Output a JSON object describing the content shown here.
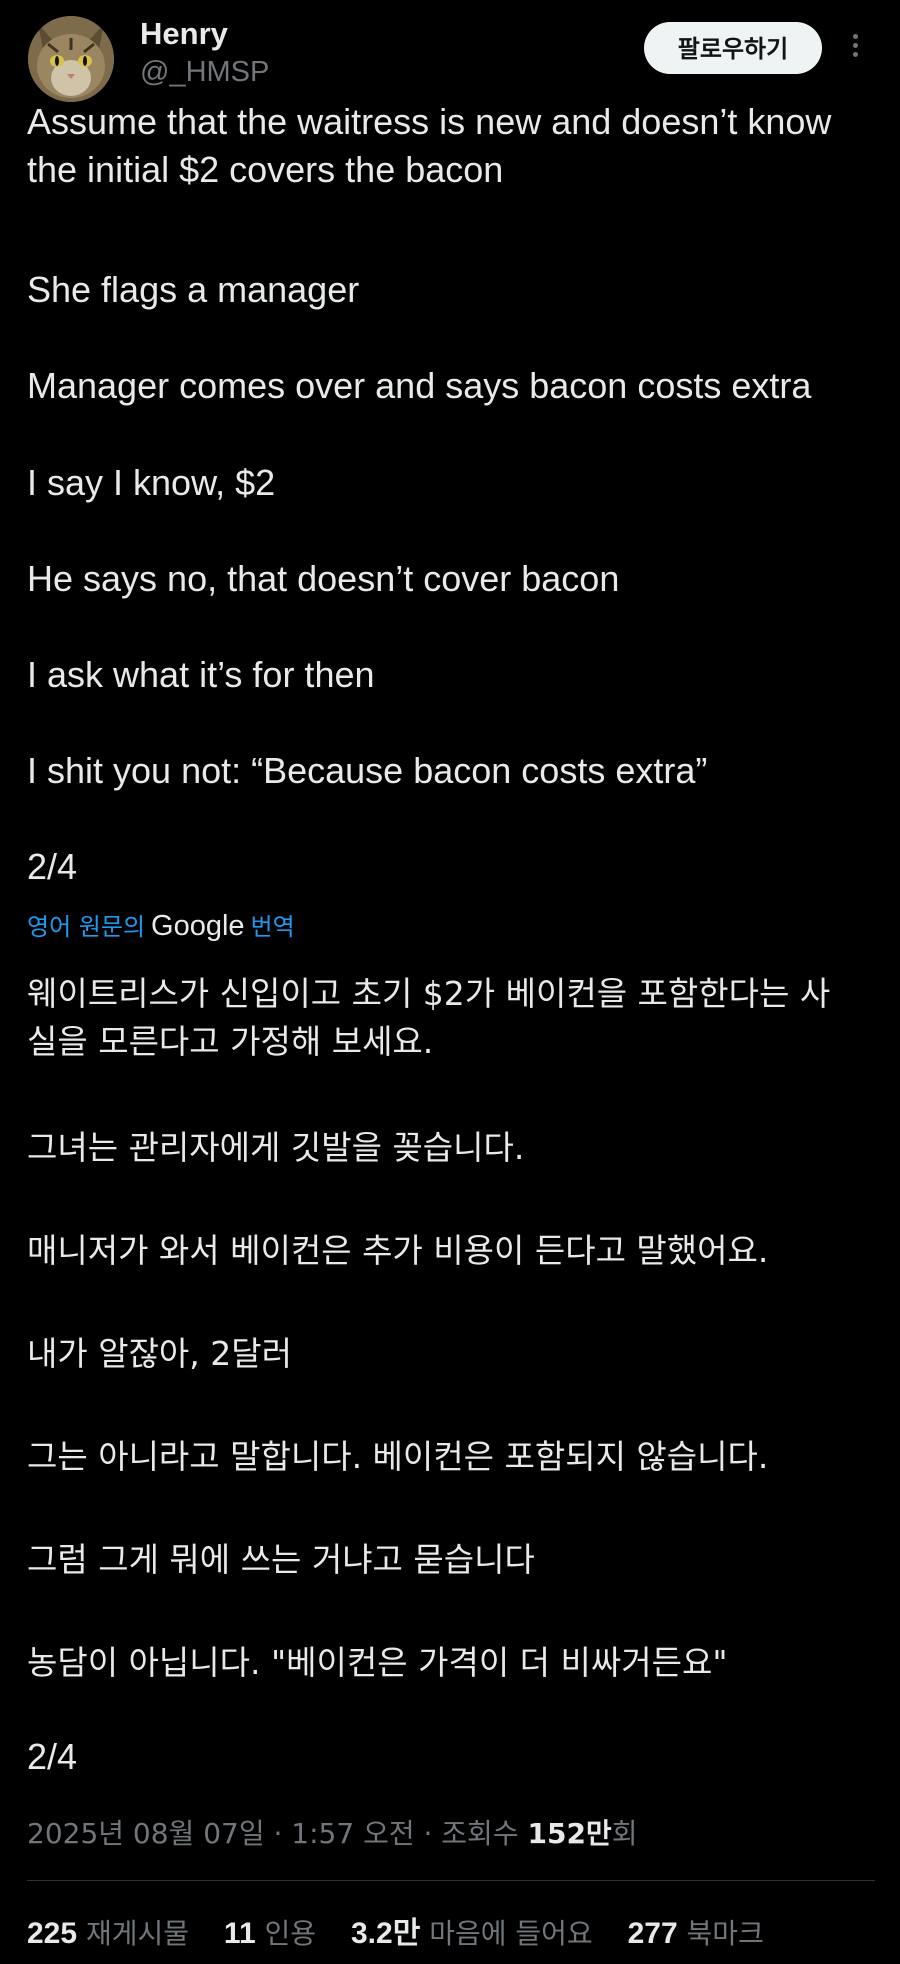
{
  "author": {
    "name": "Henry",
    "handle": "@_HMSP",
    "follow_label": "팔로우하기"
  },
  "tweet": {
    "original": [
      "Assume that the waitress is new and doesn’t know the initial $2 covers the bacon",
      "She flags a manager",
      "Manager comes over and says bacon costs extra",
      "I say I know, $2",
      "He says no, that doesn’t cover bacon",
      "I ask what it’s for then",
      "I shit you not: “Because bacon costs extra”",
      "2/4"
    ],
    "translation_label": {
      "prefix": "영어 원문의",
      "google": "Google",
      "suffix": "번역"
    },
    "translated": [
      "웨이트리스가 신입이고 초기 $2가 베이컨을 포함한다는 사실을 모른다고 가정해 보세요.",
      "그녀는 관리자에게 깃발을 꽂습니다.",
      "매니저가 와서 베이컨은 추가 비용이 든다고 말했어요.",
      "내가 알잖아, 2달러",
      "그는 아니라고 말합니다. 베이컨은 포함되지 않습니다.",
      "그럼 그게 뭐에 쓰는 거냐고 묻습니다",
      "농담이 아닙니다. \"베이컨은 가격이 더 비싸거든요\"",
      "2/4"
    ]
  },
  "meta": {
    "date_time": "2025년 08월 07일 · 1:57 오전 · 조회수 ",
    "views": "152만",
    "views_suffix": "회"
  },
  "stats": {
    "reposts_count": "225",
    "reposts_label": "재게시물",
    "quotes_count": "11",
    "quotes_label": "인용",
    "likes_count": "3.2만",
    "likes_label": "마음에 들어요",
    "bookmarks_count": "277",
    "bookmarks_label": "북마크"
  }
}
